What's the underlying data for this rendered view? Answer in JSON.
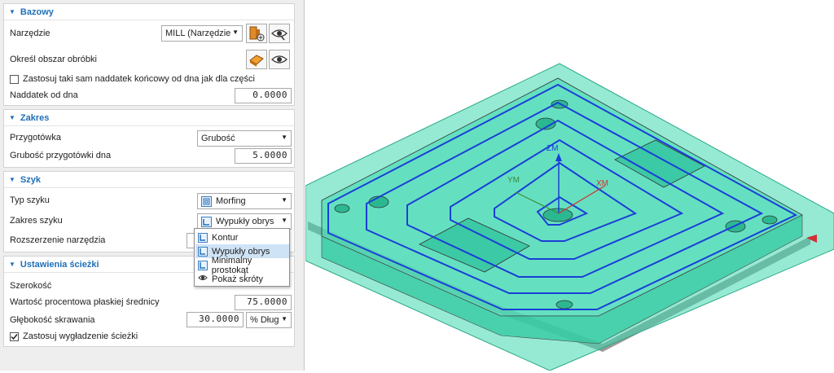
{
  "colors": {
    "accent": "#1f6fb8",
    "toolpath": "#1a3fd6",
    "stock": "#3fd9b0",
    "part_side": "#9a9a9a"
  },
  "bazowy": {
    "title": "Bazowy",
    "tool_label": "Narzędzie",
    "tool_value": "MILL (Narzędzie f",
    "area_label": "Określ obszar obróbki",
    "same_allowance_label": "Zastosuj taki sam naddatek końcowy od dna jak dla części",
    "floor_allowance_label": "Naddatek od dna",
    "floor_allowance_value": "0.0000"
  },
  "zakres": {
    "title": "Zakres",
    "blank_label": "Przygotówka",
    "blank_value": "Grubość",
    "blank_thickness_label": "Grubość przygotówki dna",
    "blank_thickness_value": "5.0000"
  },
  "szyk": {
    "title": "Szyk",
    "pattern_type_label": "Typ szyku",
    "pattern_type_value": "Morfing",
    "pattern_range_label": "Zakres szyku",
    "pattern_range_value": "Wypukły obrys",
    "tool_extension_label": "Rozszerzenie narzędzia",
    "dropdown_options": [
      "Kontur",
      "Wypukły obrys",
      "Minimalny prostokąt",
      "Pokaż skróty"
    ]
  },
  "ustawienia": {
    "title": "Ustawienia ścieżki",
    "width_label": "Szerokość",
    "percent_label": "Wartość procentowa płaskiej średnicy",
    "percent_value": "75.0000",
    "depth_label": "Głębokość skrawania",
    "depth_value": "30.0000",
    "depth_unit": "% Dług",
    "smoothing_label": "Zastosuj wygładzenie ścieżki"
  },
  "viewport": {
    "axis_z": "ZM",
    "axis_y": "YM",
    "axis_x": "XM"
  }
}
